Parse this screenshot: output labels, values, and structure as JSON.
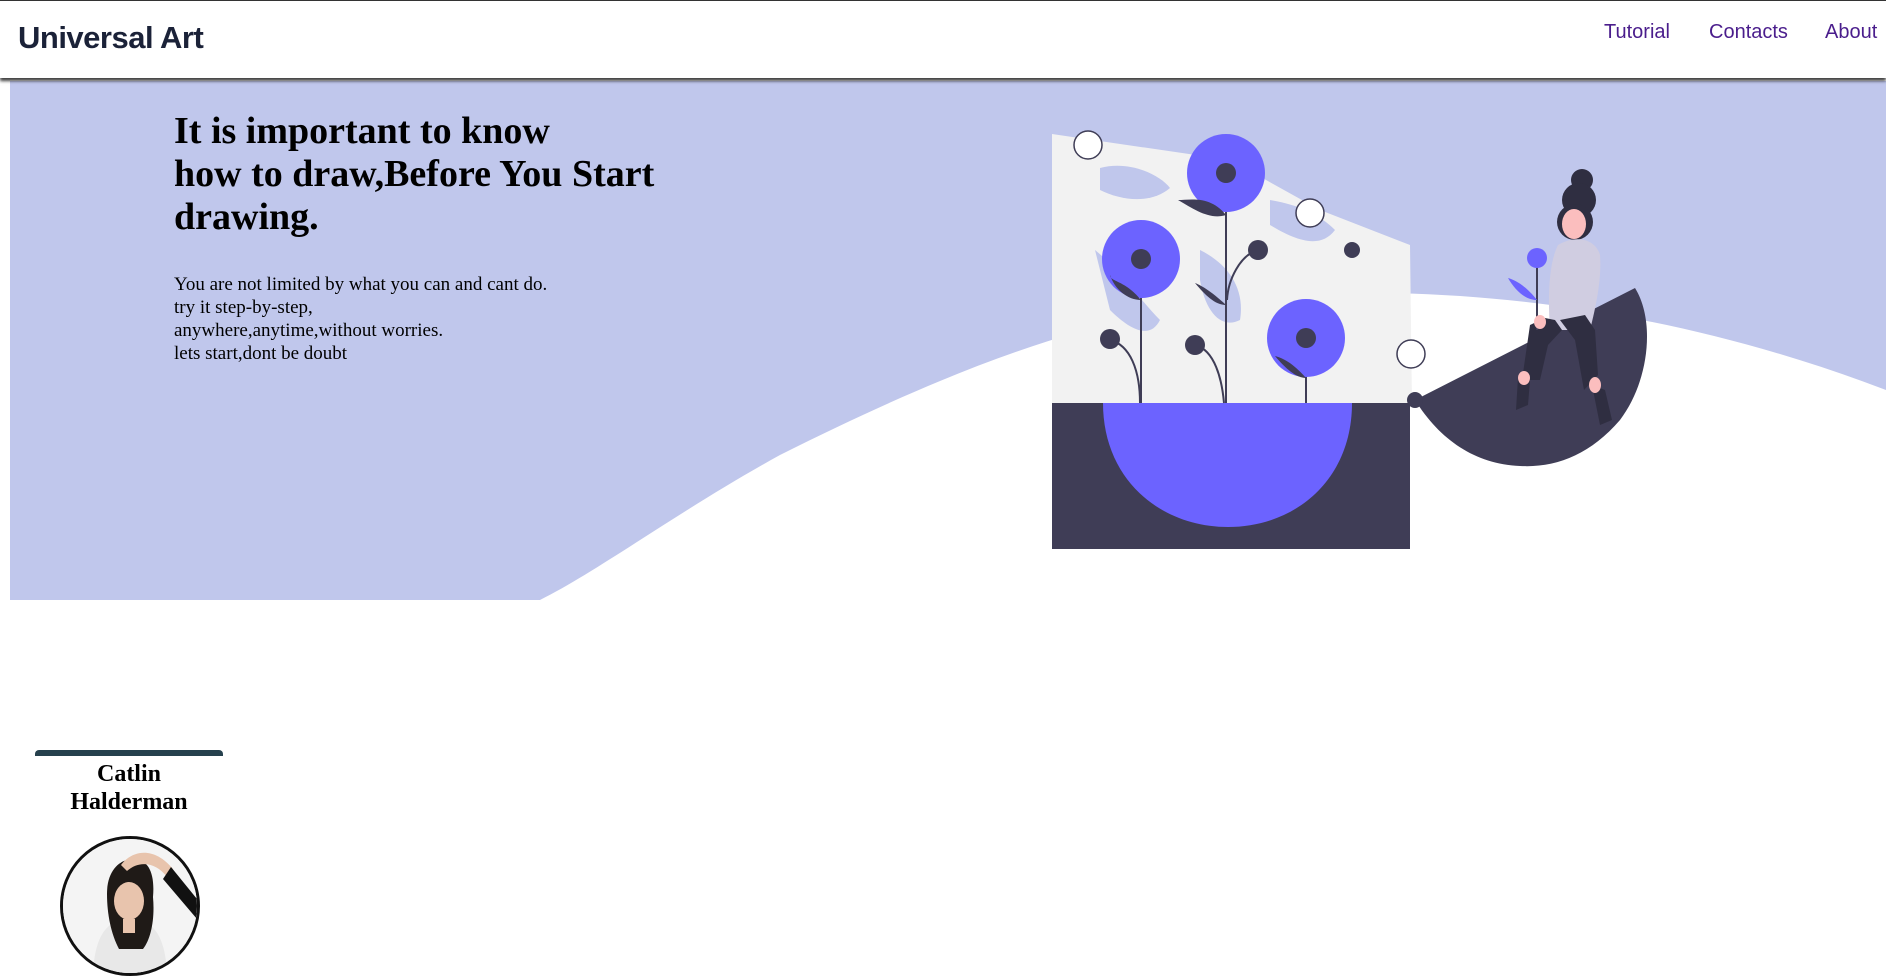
{
  "navbar": {
    "brand": "Universal Art",
    "links": [
      {
        "label": "Tutorial"
      },
      {
        "label": "Contacts"
      },
      {
        "label": "About"
      }
    ],
    "link_color": "#4a1d8c"
  },
  "hero": {
    "title_lines": [
      "It is important to know",
      "how to draw,Before You Start",
      "drawing."
    ],
    "subtitle_lines": [
      "You are not limited by what you can and cant do.",
      "try it step-by-step,",
      "anywhere,anytime,without worries.",
      "lets start,dont be doubt"
    ],
    "background_color": "#c0c7ec",
    "accent_color": "#6c63ff",
    "dark_color": "#3f3d56"
  },
  "illustration": {
    "icon": "flowers-and-woman-illustration"
  },
  "profile_card": {
    "name_lines": [
      "Catlin",
      "Halderman"
    ],
    "avatar_icon": "woman-portrait-avatar"
  }
}
